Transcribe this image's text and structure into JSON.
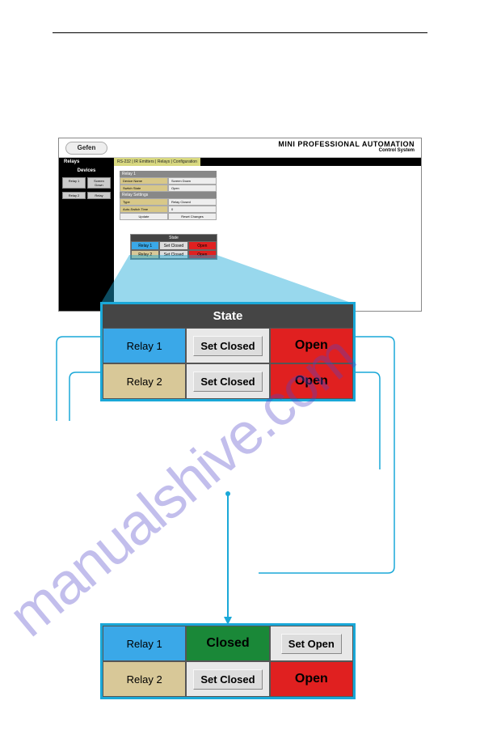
{
  "app": {
    "logo": "Gefen",
    "title": "MINI PROFESSIONAL AUTOMATION",
    "subtitle": "Control System",
    "nav_relays": "Relays",
    "menu_items": "RS-232 | IR Emitters | Relays | Configuration",
    "sidebar_devices": "Devices",
    "sidebar_relay1": "Relay 1",
    "sidebar_btn1": "Screen Down",
    "sidebar_relay2": "Relay 2",
    "sidebar_btn2": "Relay"
  },
  "form": {
    "header1": "Relay 1",
    "r1_label": "Device Name",
    "r1_value": "Screen Down",
    "r2_label": "Switch State",
    "r2_value": "Open",
    "header2": "Relay Settings",
    "r3_label": "Type",
    "r3_value": "Relay Closed",
    "r4_label": "Auto-Switch Time",
    "r4_value": "0",
    "btn_update": "Update",
    "btn_reset": "Reset Changes"
  },
  "mini": {
    "header": "State",
    "r1": "Relay 1",
    "r1b": "Set Closed",
    "r1c": "Open",
    "r2": "Relay 2",
    "r2b": "Set Closed",
    "r2c": "Open"
  },
  "state_table": {
    "header": "State",
    "rows": [
      {
        "label": "Relay 1",
        "label_style": "blue",
        "btn": "Set Closed",
        "status": "Open"
      },
      {
        "label": "Relay 2",
        "label_style": "tan",
        "btn": "Set Closed",
        "status": "Open"
      }
    ]
  },
  "result_table": {
    "rows": [
      {
        "label": "Relay 1",
        "label_style": "blue",
        "mid": "Closed",
        "mid_style": "green",
        "right": "Set Open",
        "right_style": "grey"
      },
      {
        "label": "Relay 2",
        "label_style": "tan",
        "mid": "Set Closed",
        "mid_style": "grey",
        "right": "Open",
        "right_style": "red"
      }
    ]
  },
  "watermark": "manualshive.com"
}
